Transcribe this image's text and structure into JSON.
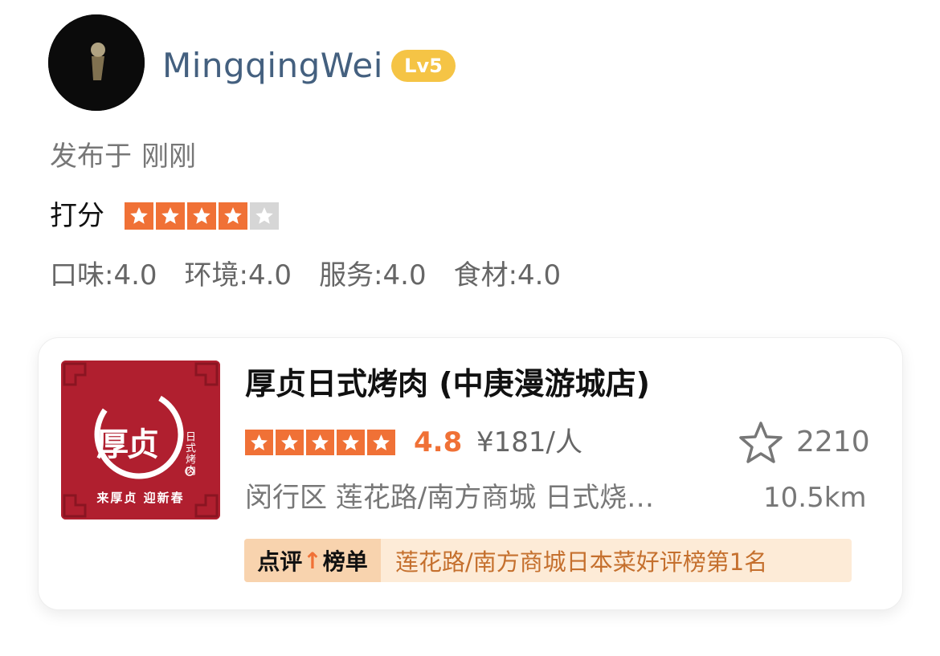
{
  "user": {
    "name": "MingqingWei",
    "level": "Lv5",
    "posted_label": "发布于",
    "posted_time": "刚刚"
  },
  "review": {
    "score_label": "打分",
    "star_rating": 4,
    "star_max": 5,
    "subscores": [
      {
        "label": "口味:4.0"
      },
      {
        "label": "环境:4.0"
      },
      {
        "label": "服务:4.0"
      },
      {
        "label": "食材:4.0"
      }
    ]
  },
  "shop": {
    "thumb_logo": "厚贞",
    "thumb_side": "日式烤肉",
    "thumb_slogan": "来厚贞 迎新春",
    "name": "厚贞日式烤肉 (中庚漫游城店)",
    "star_rating": 5,
    "rating": "4.8",
    "price": "¥181/人",
    "favorites": "2210",
    "location_category": "闵行区 莲花路/南方商城 日式烧…",
    "distance": "10.5km",
    "rank_tag_left": "点评",
    "rank_tag_arrow": "↑",
    "rank_tag_right": "榜单",
    "rank_text": "莲花路/南方商城日本菜好评榜第1名"
  },
  "colors": {
    "accent_orange": "#f07136",
    "username_blue": "#44607f",
    "level_badge": "#f5c445",
    "thumb_red": "#b01f2f",
    "rank_bg": "#fdebd7",
    "rank_text": "#c5702e"
  }
}
